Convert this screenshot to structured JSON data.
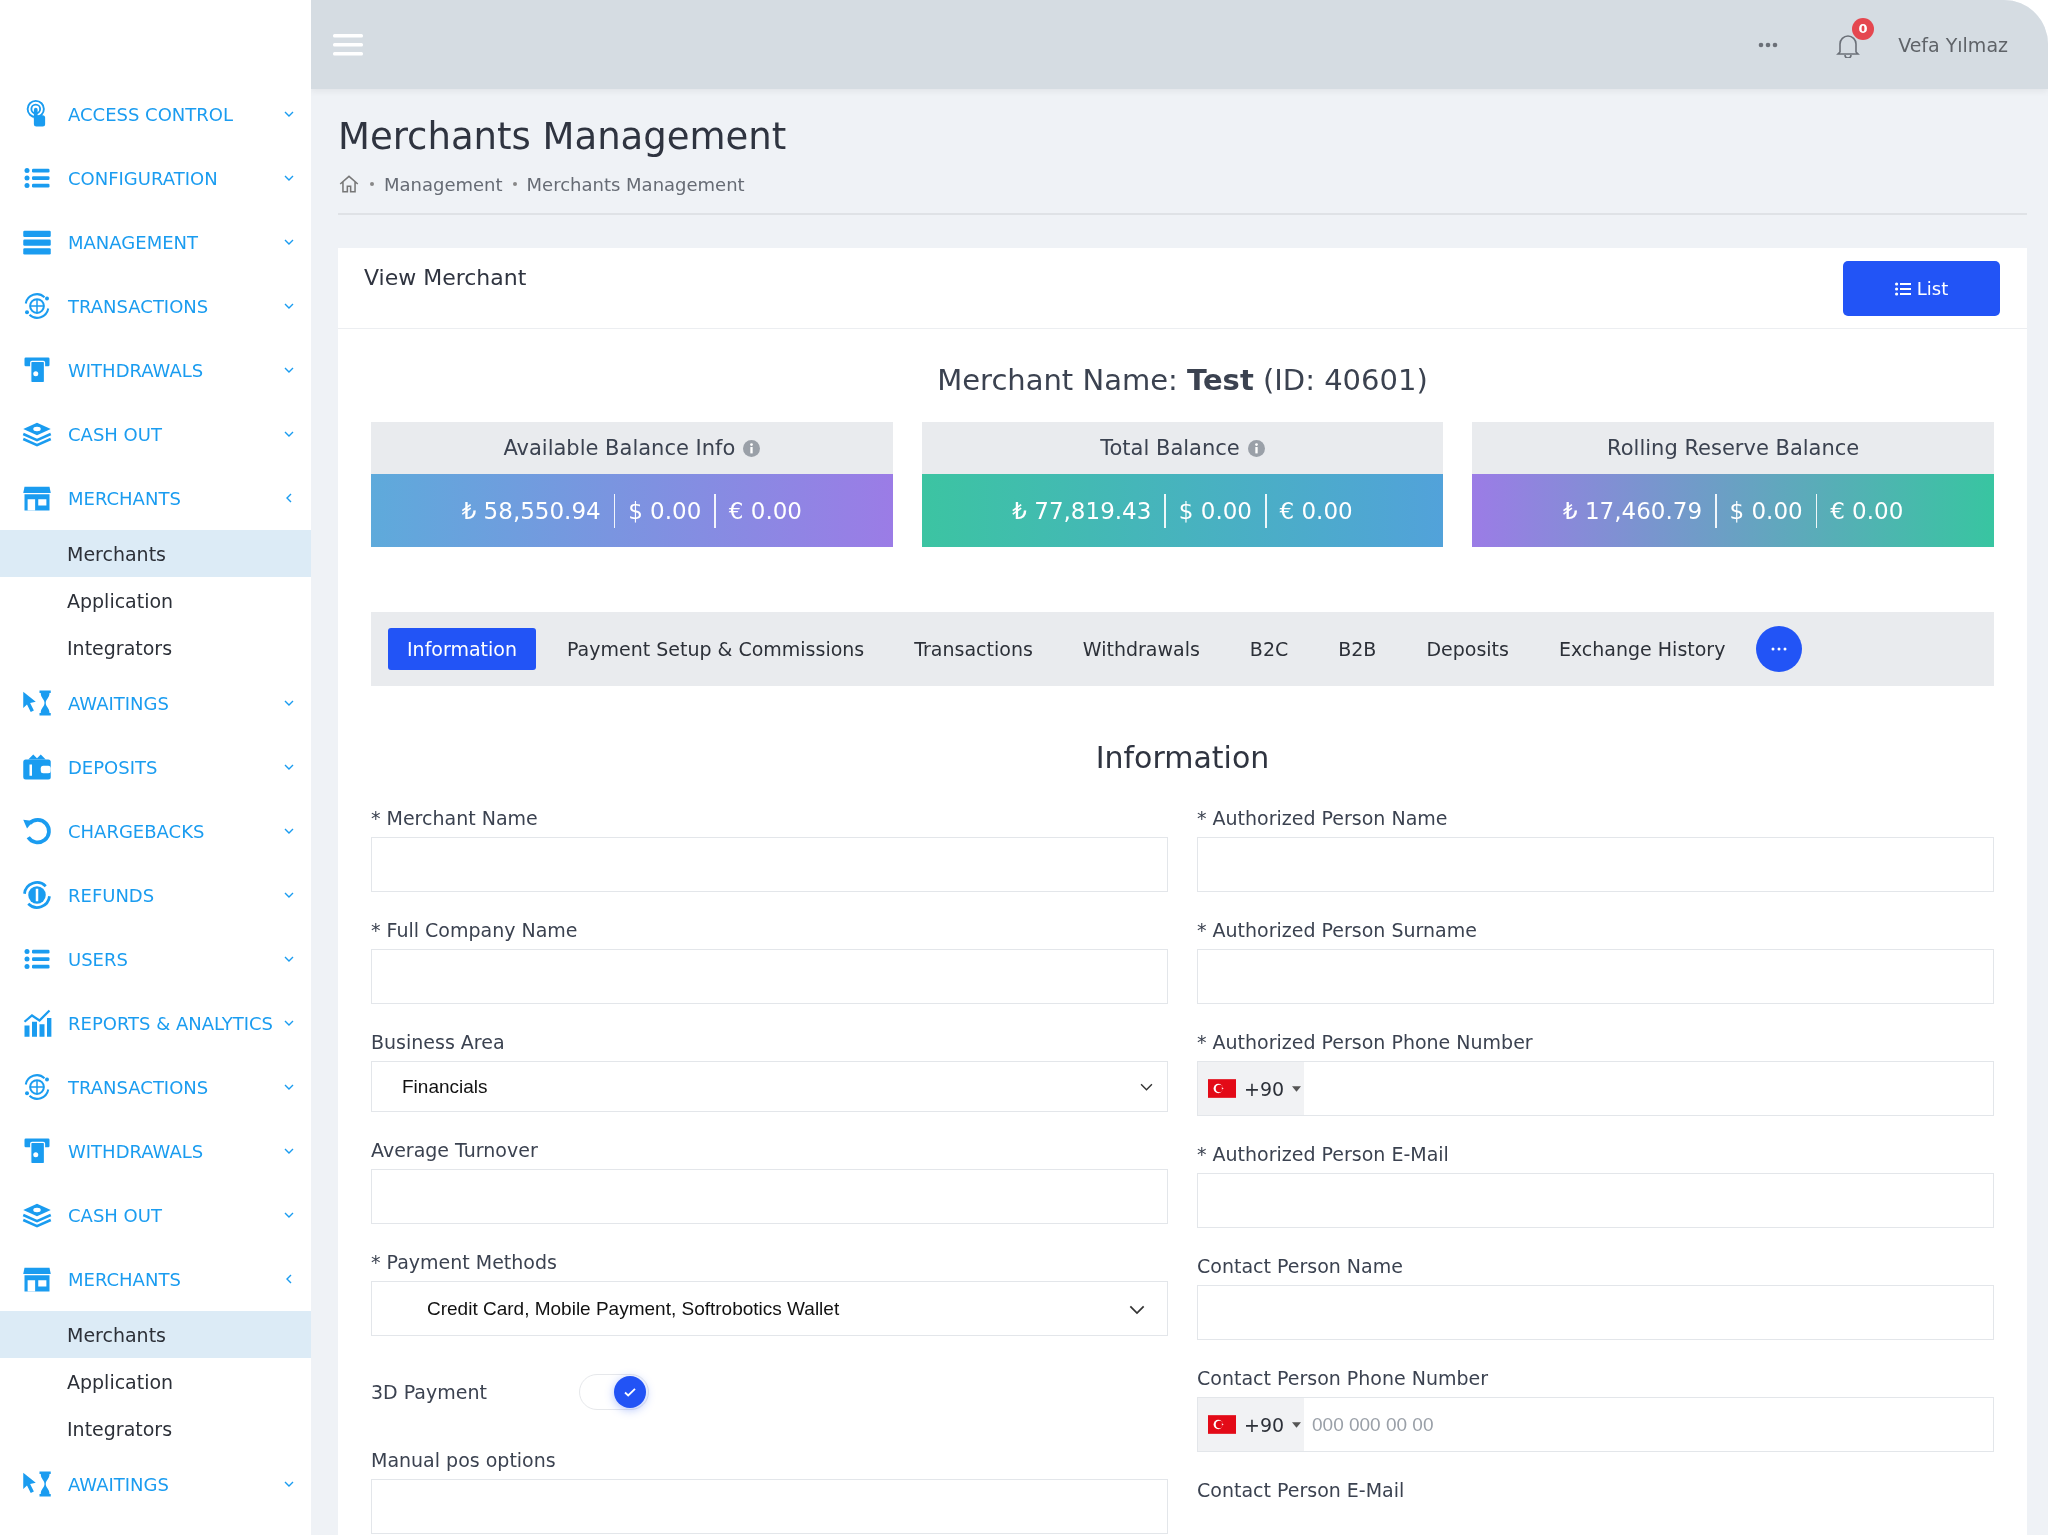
{
  "header": {
    "user_name": "Vefa Yılmaz",
    "notification_count": "0"
  },
  "sidebar": {
    "items": [
      {
        "label": "ACCESS CONTROL",
        "expanded": false
      },
      {
        "label": "CONFIGURATION",
        "expanded": false
      },
      {
        "label": "MANAGEMENT",
        "expanded": false
      },
      {
        "label": "TRANSACTIONS",
        "expanded": false
      },
      {
        "label": "WITHDRAWALS",
        "expanded": false
      },
      {
        "label": "CASH OUT",
        "expanded": false
      },
      {
        "label": "MERCHANTS",
        "expanded": true,
        "children": [
          {
            "label": "Merchants",
            "selected": true
          },
          {
            "label": "Application",
            "selected": false
          },
          {
            "label": "Integrators",
            "selected": false
          }
        ]
      },
      {
        "label": "AWAITINGS",
        "expanded": false
      },
      {
        "label": "DEPOSITS",
        "expanded": false
      },
      {
        "label": "CHARGEBACKS",
        "expanded": false
      },
      {
        "label": "REFUNDS",
        "expanded": false
      },
      {
        "label": "USERS",
        "expanded": false
      },
      {
        "label": "REPORTS & ANALYTICS",
        "expanded": false
      },
      {
        "label": "TRANSACTIONS",
        "expanded": false
      },
      {
        "label": "WITHDRAWALS",
        "expanded": false
      },
      {
        "label": "CASH OUT",
        "expanded": false
      },
      {
        "label": "MERCHANTS",
        "expanded": true,
        "children": [
          {
            "label": "Merchants",
            "selected": true
          },
          {
            "label": "Application",
            "selected": false
          },
          {
            "label": "Integrators",
            "selected": false
          }
        ]
      },
      {
        "label": "AWAITINGS",
        "expanded": false
      }
    ]
  },
  "page": {
    "title": "Merchants Management",
    "breadcrumb": [
      "Management",
      "Merchants Management"
    ]
  },
  "card": {
    "title": "View Merchant",
    "list_button": "List",
    "merchant_heading": "Merchant Name: **Test** (ID: 40601)"
  },
  "balances": [
    {
      "title": "Available Balance Info",
      "info": true,
      "color": "#5eaadb",
      "amounts": [
        "₺ 58,550.94",
        "$ 0.00",
        "€ 0.00"
      ]
    },
    {
      "title": "Total Balance",
      "info": true,
      "color": "#3cc4a2",
      "amounts": [
        "₺ 77,819.43",
        "$ 0.00",
        "€ 0.00"
      ]
    },
    {
      "title": "Rolling Reserve Balance",
      "info": false,
      "color": "#9b7ce6",
      "amounts": [
        "₺ 17,460.79",
        "$ 0.00",
        "€ 0.00"
      ]
    }
  ],
  "tabs": [
    {
      "label": "Information",
      "selected": true
    },
    {
      "label": "Payment Setup & Commissions",
      "selected": false
    },
    {
      "label": "Transactions",
      "selected": false
    },
    {
      "label": "Withdrawals",
      "selected": false
    },
    {
      "label": "B2C",
      "selected": false
    },
    {
      "label": "B2B",
      "selected": false
    },
    {
      "label": "Deposits",
      "selected": false
    },
    {
      "label": "Exchange History",
      "selected": false
    }
  ],
  "section_title": "Information",
  "form": {
    "left": [
      {
        "kind": "text",
        "label": "* Merchant Name"
      },
      {
        "kind": "text",
        "label": "* Full Company Name"
      },
      {
        "kind": "select",
        "label": "Business Area",
        "value": "Financials"
      },
      {
        "kind": "text",
        "label": "Average Turnover"
      },
      {
        "kind": "select",
        "label": "* Payment Methods",
        "value": "Credit Card, Mobile Payment, Softrobotics Wallet"
      },
      {
        "kind": "toggle",
        "label": "3D Payment",
        "on": true
      },
      {
        "kind": "text",
        "label": "Manual pos options"
      }
    ],
    "right": [
      {
        "kind": "text",
        "label": "* Authorized Person Name"
      },
      {
        "kind": "text",
        "label": "* Authorized Person Surname"
      },
      {
        "kind": "phone",
        "label": "* Authorized Person Phone Number",
        "code": "+90"
      },
      {
        "kind": "text",
        "label": "* Authorized Person E-Mail"
      },
      {
        "kind": "text",
        "label": "Contact Person Name"
      },
      {
        "kind": "phone",
        "label": "Contact Person Phone Number",
        "code": "+90",
        "placeholder": "000 000 00 00"
      },
      {
        "kind": "label",
        "label": "Contact Person E-Mail"
      }
    ]
  }
}
